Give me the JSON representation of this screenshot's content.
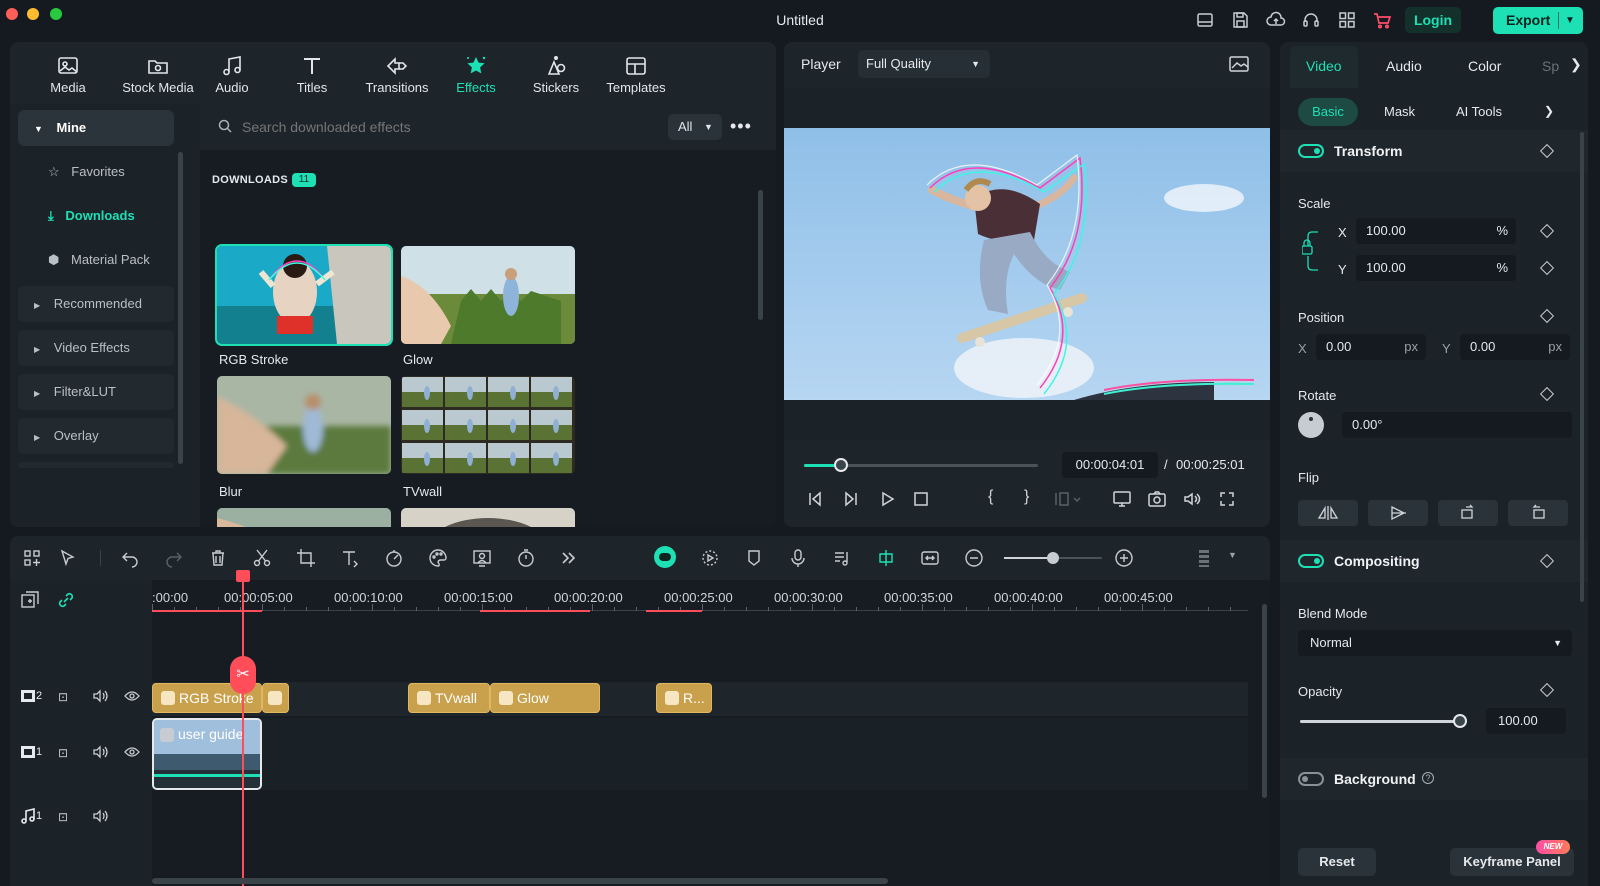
{
  "window": {
    "title": "Untitled"
  },
  "header": {
    "login_label": "Login",
    "export_label": "Export"
  },
  "library": {
    "tabs": [
      {
        "label": "Media"
      },
      {
        "label": "Stock Media"
      },
      {
        "label": "Audio"
      },
      {
        "label": "Titles"
      },
      {
        "label": "Transitions"
      },
      {
        "label": "Effects"
      },
      {
        "label": "Stickers"
      },
      {
        "label": "Templates"
      }
    ],
    "active_tab": "Effects",
    "sidebar": {
      "mine": "Mine",
      "favorites": "Favorites",
      "downloads": "Downloads",
      "material_pack": "Material Pack",
      "recommended": "Recommended",
      "video_effects": "Video Effects",
      "filter_lut": "Filter&LUT",
      "overlay": "Overlay"
    },
    "search_placeholder": "Search downloaded effects",
    "filter_value": "All",
    "downloads_heading": "DOWNLOADS",
    "downloads_count": "11",
    "effects": [
      {
        "label": "RGB Stroke",
        "selected": true
      },
      {
        "label": "Glow",
        "selected": false
      },
      {
        "label": "Blur",
        "selected": false
      },
      {
        "label": "TVwall",
        "selected": false
      }
    ]
  },
  "player": {
    "label": "Player",
    "quality": "Full Quality",
    "current_time": "00:00:04:01",
    "separator": "/",
    "total_time": "00:00:25:01",
    "progress": 0.16
  },
  "properties": {
    "tabs": {
      "video": "Video",
      "audio": "Audio",
      "color": "Color",
      "more": "Sp"
    },
    "subtabs": {
      "basic": "Basic",
      "mask": "Mask",
      "ai_tools": "AI Tools"
    },
    "transform": {
      "title": "Transform",
      "scale_label": "Scale",
      "x_label": "X",
      "y_label": "Y",
      "scale_x": "100.00",
      "scale_y": "100.00",
      "percent": "%",
      "position_label": "Position",
      "pos_x": "0.00",
      "pos_y": "0.00",
      "px": "px",
      "rotate_label": "Rotate",
      "rotate_value": "0.00°",
      "flip_label": "Flip"
    },
    "compositing": {
      "title": "Compositing",
      "blend_label": "Blend Mode",
      "blend_value": "Normal",
      "opacity_label": "Opacity",
      "opacity_value": "100.00",
      "opacity_level": 1.0
    },
    "background": {
      "title": "Background"
    },
    "reset_label": "Reset",
    "keyframe_label": "Keyframe Panel",
    "new_badge": "NEW"
  },
  "timeline": {
    "ruler": [
      ":00:00",
      "00:00:05:00",
      "00:00:10:00",
      "00:00:15:00",
      "00:00:20:00",
      "00:00:25:00",
      "00:00:30:00",
      "00:00:35:00",
      "00:00:40:00",
      "00:00:45:00"
    ],
    "track_numbers": {
      "v2": "2",
      "v1": "1",
      "a1": "1"
    },
    "clips": {
      "rgb_stroke": "RGB Stroke",
      "tvwall": "TVwall",
      "glow": "Glow",
      "r": "R...",
      "video": "user guide"
    },
    "zoom_level": 0.5
  },
  "colors": {
    "accent": "#1ee0b5",
    "playhead": "#ff4d5a",
    "effect_clip": "#c9a04b",
    "panel_bg": "#1b2228"
  }
}
